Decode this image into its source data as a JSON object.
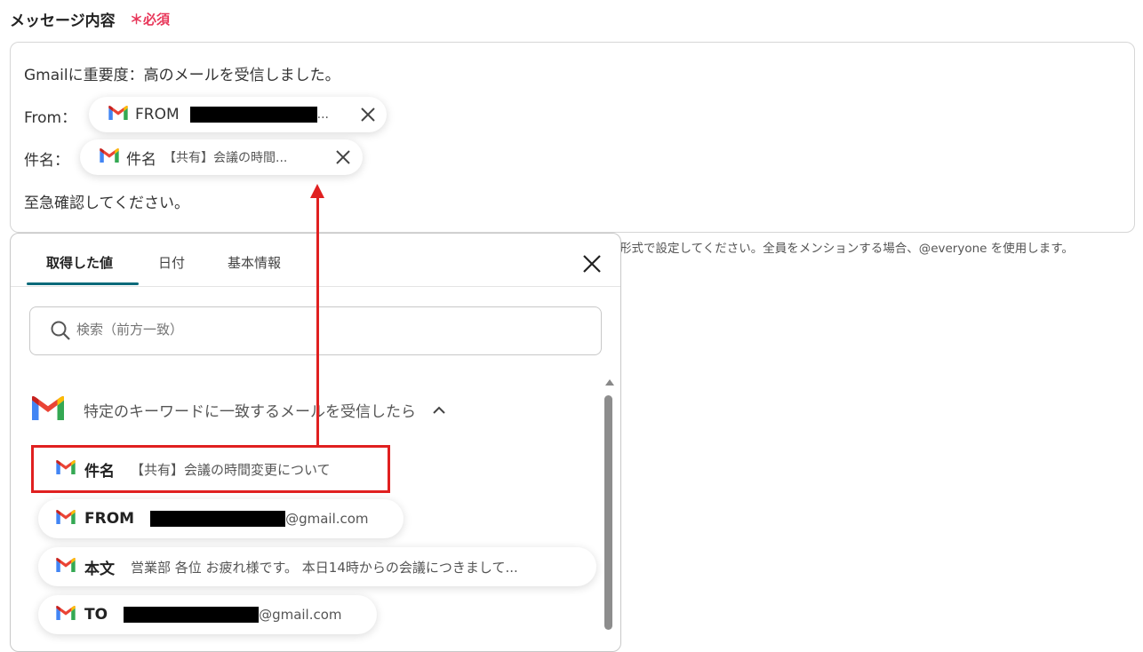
{
  "field": {
    "label": "メッセージ内容",
    "required_mark": "＊必須"
  },
  "message": {
    "line1": "Gmailに重要度：高のメールを受信しました。",
    "from_label": "From：",
    "subject_label": "件名：",
    "line4": "至急確認してください。",
    "from_chip": {
      "name": "FROM",
      "value_suffix": "...",
      "icon": "gmail-icon"
    },
    "subject_chip": {
      "name": "件名",
      "value": "【共有】会議の時間...",
      "icon": "gmail-icon"
    }
  },
  "hint": "形式で設定してください。全員をメンションする場合、@everyone を使用します。",
  "panel": {
    "tabs": [
      "取得した値",
      "日付",
      "基本情報"
    ],
    "active_tab": 0,
    "search_placeholder": "検索（前方一致）",
    "group_title": "特定のキーワードに一致するメールを受信したら",
    "items": [
      {
        "name": "件名",
        "value": "【共有】会議の時間変更について"
      },
      {
        "name": "FROM",
        "value": "@gmail.com"
      },
      {
        "name": "本文",
        "value": "営業部 各位 お疲れ様です。 本日14時からの会議につきまして..."
      },
      {
        "name": "TO",
        "value": "@gmail.com"
      }
    ]
  },
  "colors": {
    "required": "#e8375a",
    "tab_active": "#0a6a7a",
    "annotation": "#e02020"
  }
}
